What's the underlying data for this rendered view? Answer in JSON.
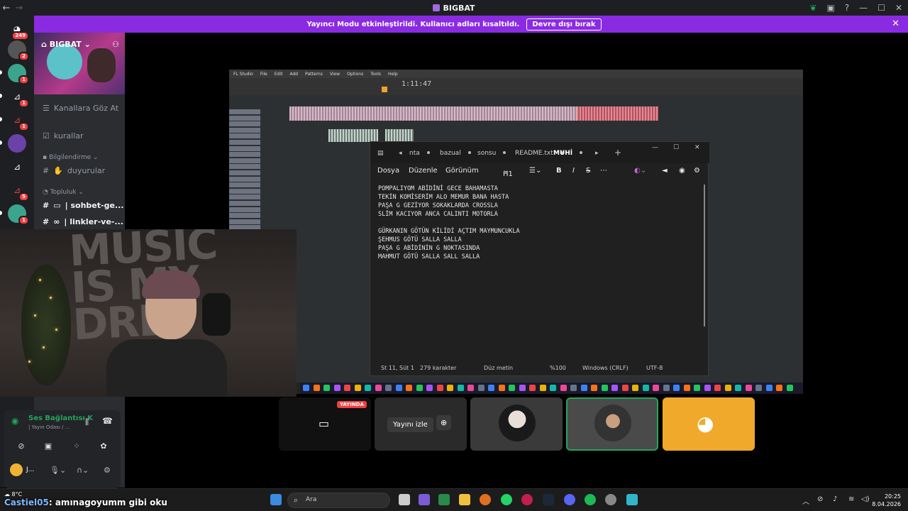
{
  "window": {
    "title": "BIGBAT",
    "back_glyph": "←",
    "forward_glyph": "→",
    "controls": {
      "minimize": "—",
      "maximize": "☐",
      "close": "✕"
    }
  },
  "banner": {
    "message": "Yayıncı Modu etkinleştirildi. Kullanıcı adları kısaltıldı.",
    "button_label": "Devre dışı bırak",
    "close_glyph": "✕"
  },
  "servers": {
    "home_badge": "249",
    "items": [
      {
        "badge": "2"
      },
      {
        "badge": "1"
      },
      {
        "badge": "1"
      },
      {
        "badge": "1"
      },
      {
        "badge": ""
      },
      {
        "badge": ""
      },
      {
        "badge": "5"
      },
      {
        "badge": "1"
      }
    ]
  },
  "sidebar": {
    "server_name": "BIGBAT",
    "channels": [
      {
        "label": "Kanallara Göz At",
        "icon": "browse-channels-icon"
      },
      {
        "label": "kurallar",
        "icon": "rules-icon"
      }
    ],
    "categories": [
      {
        "label": "Bilgilendirme",
        "channels": [
          "duyurular"
        ]
      },
      {
        "label": "Topluluk",
        "channels": [
          "| sohbet-ge...",
          "| linkler-ve-..."
        ]
      }
    ]
  },
  "voice": {
    "status": "Ses Bağlantısı K",
    "sub": "| Yayın Odası / ...",
    "user": "J..."
  },
  "notepad": {
    "tabs": [
      "nta",
      "bazual",
      "sonsu",
      "README.txt",
      "MUHİ"
    ],
    "menu": [
      "Dosya",
      "Düzenle",
      "Görünüm"
    ],
    "heading_select": "H1",
    "lines": [
      "POMPALIYOM ABİDİNİ GECE BAHAMASTA",
      "TEKİN KOMİSERİM ALO MEMUR BANA HASTA",
      "PAŞA G GEZİYOR SOKAKLARDA CROSSLA",
      "SLİM KACIYOR ANCA CALINTI MOTORLA",
      "",
      "GÜRKANIN GÖTÜN KİLİDİ AÇTIM MAYMUNCUKLA",
      "ŞEHMUS GÖTÜ SALLA SALLA",
      "PAŞA G ABİDİNİN G NOKTASINDA",
      "MAHMUT GÖTÜ SALLA SALL SALLA"
    ],
    "status": {
      "position": "St 11, Süt 1",
      "chars": "279 karakter",
      "format": "Düz metin",
      "zoom": "%100",
      "line_ending": "Windows (CRLF)",
      "encoding": "UTF-8"
    }
  },
  "flstudio": {
    "time": "1:11:47"
  },
  "tiles": {
    "live_badge": "YAYINDA",
    "watch_label": "Yayını izle"
  },
  "taskbar": {
    "weather": "8°C",
    "caption_nick": "Castiel05",
    "caption_text": ": amınagoyumm gibi oku",
    "search_placeholder": "Ara",
    "time": "20:25",
    "date": "8.04.2026"
  }
}
